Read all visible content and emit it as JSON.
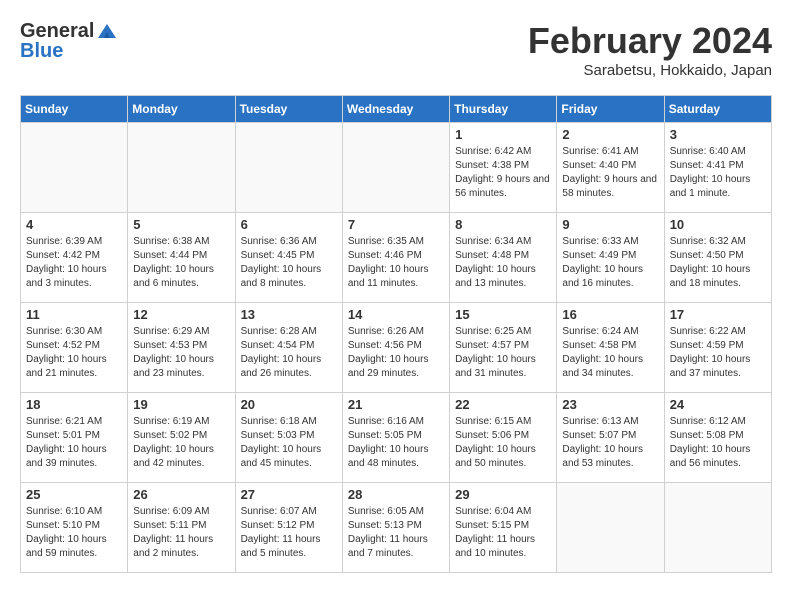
{
  "header": {
    "logo_general": "General",
    "logo_blue": "Blue",
    "month": "February 2024",
    "location": "Sarabetsu, Hokkaido, Japan"
  },
  "weekdays": [
    "Sunday",
    "Monday",
    "Tuesday",
    "Wednesday",
    "Thursday",
    "Friday",
    "Saturday"
  ],
  "weeks": [
    [
      {
        "day": "",
        "empty": true
      },
      {
        "day": "",
        "empty": true
      },
      {
        "day": "",
        "empty": true
      },
      {
        "day": "",
        "empty": true
      },
      {
        "day": "1",
        "sunrise": "6:42 AM",
        "sunset": "4:38 PM",
        "daylight": "9 hours and 56 minutes."
      },
      {
        "day": "2",
        "sunrise": "6:41 AM",
        "sunset": "4:40 PM",
        "daylight": "9 hours and 58 minutes."
      },
      {
        "day": "3",
        "sunrise": "6:40 AM",
        "sunset": "4:41 PM",
        "daylight": "10 hours and 1 minute."
      }
    ],
    [
      {
        "day": "4",
        "sunrise": "6:39 AM",
        "sunset": "4:42 PM",
        "daylight": "10 hours and 3 minutes."
      },
      {
        "day": "5",
        "sunrise": "6:38 AM",
        "sunset": "4:44 PM",
        "daylight": "10 hours and 6 minutes."
      },
      {
        "day": "6",
        "sunrise": "6:36 AM",
        "sunset": "4:45 PM",
        "daylight": "10 hours and 8 minutes."
      },
      {
        "day": "7",
        "sunrise": "6:35 AM",
        "sunset": "4:46 PM",
        "daylight": "10 hours and 11 minutes."
      },
      {
        "day": "8",
        "sunrise": "6:34 AM",
        "sunset": "4:48 PM",
        "daylight": "10 hours and 13 minutes."
      },
      {
        "day": "9",
        "sunrise": "6:33 AM",
        "sunset": "4:49 PM",
        "daylight": "10 hours and 16 minutes."
      },
      {
        "day": "10",
        "sunrise": "6:32 AM",
        "sunset": "4:50 PM",
        "daylight": "10 hours and 18 minutes."
      }
    ],
    [
      {
        "day": "11",
        "sunrise": "6:30 AM",
        "sunset": "4:52 PM",
        "daylight": "10 hours and 21 minutes."
      },
      {
        "day": "12",
        "sunrise": "6:29 AM",
        "sunset": "4:53 PM",
        "daylight": "10 hours and 23 minutes."
      },
      {
        "day": "13",
        "sunrise": "6:28 AM",
        "sunset": "4:54 PM",
        "daylight": "10 hours and 26 minutes."
      },
      {
        "day": "14",
        "sunrise": "6:26 AM",
        "sunset": "4:56 PM",
        "daylight": "10 hours and 29 minutes."
      },
      {
        "day": "15",
        "sunrise": "6:25 AM",
        "sunset": "4:57 PM",
        "daylight": "10 hours and 31 minutes."
      },
      {
        "day": "16",
        "sunrise": "6:24 AM",
        "sunset": "4:58 PM",
        "daylight": "10 hours and 34 minutes."
      },
      {
        "day": "17",
        "sunrise": "6:22 AM",
        "sunset": "4:59 PM",
        "daylight": "10 hours and 37 minutes."
      }
    ],
    [
      {
        "day": "18",
        "sunrise": "6:21 AM",
        "sunset": "5:01 PM",
        "daylight": "10 hours and 39 minutes."
      },
      {
        "day": "19",
        "sunrise": "6:19 AM",
        "sunset": "5:02 PM",
        "daylight": "10 hours and 42 minutes."
      },
      {
        "day": "20",
        "sunrise": "6:18 AM",
        "sunset": "5:03 PM",
        "daylight": "10 hours and 45 minutes."
      },
      {
        "day": "21",
        "sunrise": "6:16 AM",
        "sunset": "5:05 PM",
        "daylight": "10 hours and 48 minutes."
      },
      {
        "day": "22",
        "sunrise": "6:15 AM",
        "sunset": "5:06 PM",
        "daylight": "10 hours and 50 minutes."
      },
      {
        "day": "23",
        "sunrise": "6:13 AM",
        "sunset": "5:07 PM",
        "daylight": "10 hours and 53 minutes."
      },
      {
        "day": "24",
        "sunrise": "6:12 AM",
        "sunset": "5:08 PM",
        "daylight": "10 hours and 56 minutes."
      }
    ],
    [
      {
        "day": "25",
        "sunrise": "6:10 AM",
        "sunset": "5:10 PM",
        "daylight": "10 hours and 59 minutes."
      },
      {
        "day": "26",
        "sunrise": "6:09 AM",
        "sunset": "5:11 PM",
        "daylight": "11 hours and 2 minutes."
      },
      {
        "day": "27",
        "sunrise": "6:07 AM",
        "sunset": "5:12 PM",
        "daylight": "11 hours and 5 minutes."
      },
      {
        "day": "28",
        "sunrise": "6:05 AM",
        "sunset": "5:13 PM",
        "daylight": "11 hours and 7 minutes."
      },
      {
        "day": "29",
        "sunrise": "6:04 AM",
        "sunset": "5:15 PM",
        "daylight": "11 hours and 10 minutes."
      },
      {
        "day": "",
        "empty": true
      },
      {
        "day": "",
        "empty": true
      }
    ]
  ],
  "labels": {
    "sunrise_prefix": "Sunrise: ",
    "sunset_prefix": "Sunset: ",
    "daylight_prefix": "Daylight: "
  }
}
